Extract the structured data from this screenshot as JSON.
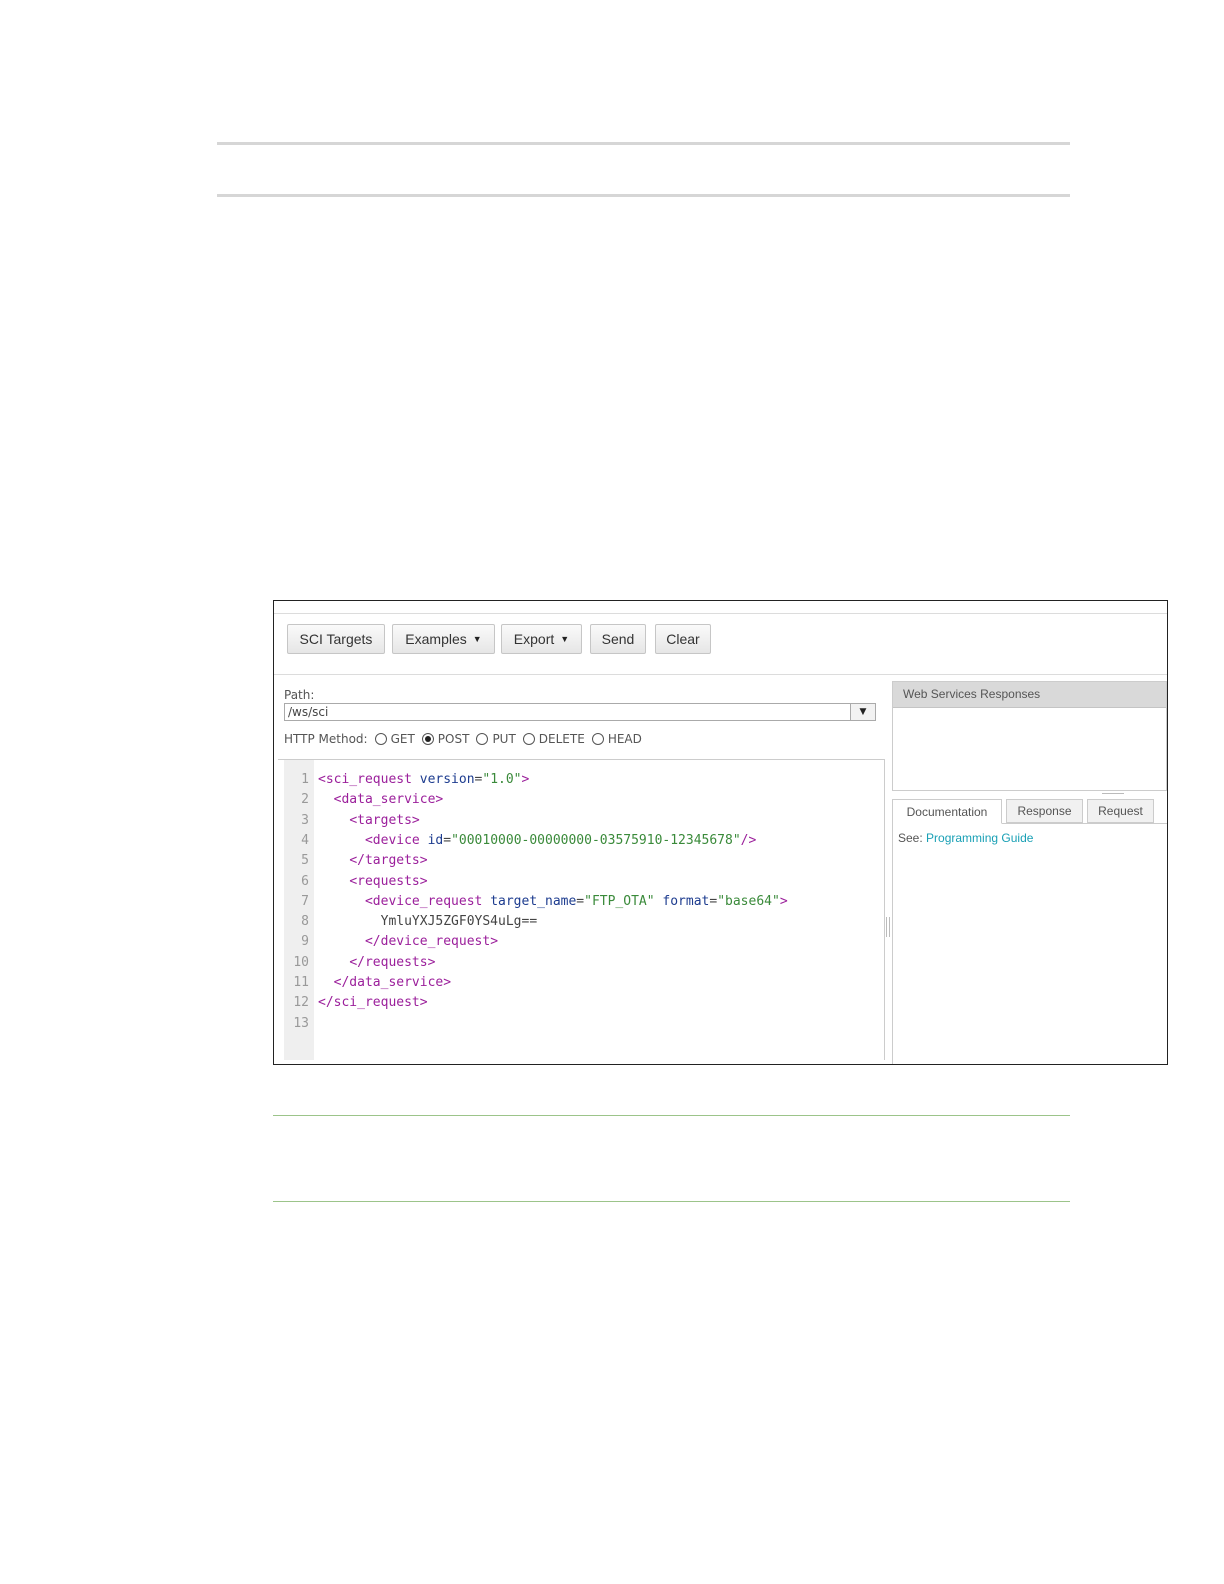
{
  "toolbar": {
    "sci_targets": "SCI Targets",
    "examples": "Examples",
    "export": "Export",
    "send": "Send",
    "clear": "Clear"
  },
  "path": {
    "label": "Path:",
    "value": "/ws/sci"
  },
  "http_method": {
    "label": "HTTP Method:",
    "options": [
      "GET",
      "POST",
      "PUT",
      "DELETE",
      "HEAD"
    ],
    "selected": "POST"
  },
  "editor": {
    "line_numbers": [
      "1",
      "2",
      "3",
      "4",
      "5",
      "6",
      "7",
      "8",
      "9",
      "10",
      "11",
      "12",
      "13"
    ],
    "lines": [
      [
        [
          "tag",
          "<sci_request "
        ],
        [
          "attr",
          "version"
        ],
        [
          "txt",
          "="
        ],
        [
          "str",
          "\"1.0\""
        ],
        [
          "tag",
          ">"
        ]
      ],
      [
        [
          "txt",
          "  "
        ],
        [
          "tag",
          "<data_service>"
        ]
      ],
      [
        [
          "txt",
          "    "
        ],
        [
          "tag",
          "<targets>"
        ]
      ],
      [
        [
          "txt",
          "      "
        ],
        [
          "tag",
          "<device "
        ],
        [
          "attr",
          "id"
        ],
        [
          "txt",
          "="
        ],
        [
          "str",
          "\"00010000-00000000-03575910-12345678\""
        ],
        [
          "tag",
          "/>"
        ]
      ],
      [
        [
          "txt",
          "    "
        ],
        [
          "tag",
          "</targets>"
        ]
      ],
      [
        [
          "txt",
          "    "
        ],
        [
          "tag",
          "<requests>"
        ]
      ],
      [
        [
          "txt",
          "      "
        ],
        [
          "tag",
          "<device_request "
        ],
        [
          "attr",
          "target_name"
        ],
        [
          "txt",
          "="
        ],
        [
          "str",
          "\"FTP_OTA\""
        ],
        [
          "txt",
          " "
        ],
        [
          "attr",
          "format"
        ],
        [
          "txt",
          "="
        ],
        [
          "str",
          "\"base64\""
        ],
        [
          "tag",
          ">"
        ]
      ],
      [
        [
          "txt",
          "        YmluYXJ5ZGF0YS4uLg=="
        ]
      ],
      [
        [
          "txt",
          "      "
        ],
        [
          "tag",
          "</device_request>"
        ]
      ],
      [
        [
          "txt",
          "    "
        ],
        [
          "tag",
          "</requests>"
        ]
      ],
      [
        [
          "txt",
          "  "
        ],
        [
          "tag",
          "</data_service>"
        ]
      ],
      [
        [
          "tag",
          "</sci_request>"
        ]
      ],
      []
    ]
  },
  "responses": {
    "header": "Web Services Responses"
  },
  "tabs": {
    "documentation": "Documentation",
    "response": "Response",
    "request": "Request"
  },
  "doc": {
    "see_label": "See:",
    "link": "Programming Guide"
  }
}
